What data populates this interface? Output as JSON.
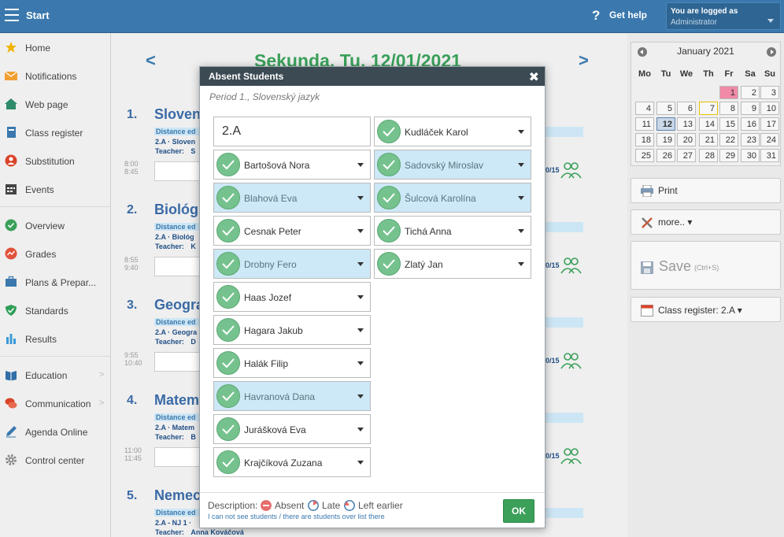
{
  "topbar": {
    "title": "Start",
    "help_icon": "?",
    "help_label": "Get help",
    "logged_label": "You are logged as",
    "user": "Administrator"
  },
  "sidebar": {
    "items": [
      {
        "label": "Home",
        "icon": "star-icon"
      },
      {
        "label": "Notifications",
        "icon": "envelope-icon"
      },
      {
        "label": "Web page",
        "icon": "house-icon"
      },
      {
        "label": "Class register",
        "icon": "book-icon"
      },
      {
        "label": "Substitution",
        "icon": "person-icon"
      },
      {
        "label": "Events",
        "icon": "calendar-icon"
      },
      {
        "label": "Overview",
        "icon": "check-circle-icon"
      },
      {
        "label": "Grades",
        "icon": "chart-circle-icon"
      },
      {
        "label": "Plans & Prepar...",
        "icon": "briefcase-icon"
      },
      {
        "label": "Standards",
        "icon": "shield-icon"
      },
      {
        "label": "Results",
        "icon": "bar-chart-icon"
      },
      {
        "label": "Education",
        "icon": "book-open-icon"
      },
      {
        "label": "Communication",
        "icon": "chat-icon"
      },
      {
        "label": "Agenda Online",
        "icon": "pen-icon"
      },
      {
        "label": "Control center",
        "icon": "gear-icon"
      }
    ]
  },
  "main": {
    "day_title": "Sekunda, Tu, 12/01/2021",
    "periods": [
      {
        "num": "1.",
        "name": "Sloven",
        "strip": "Distance ed",
        "line1": "2.A · Sloven",
        "line2_label": "Teacher:",
        "line2_value": "S",
        "t1": "8:00",
        "t2": "8:45",
        "count": "0/15"
      },
      {
        "num": "2.",
        "name": "Biológ",
        "strip": "Distance ed",
        "line1": "2.A · Biológ",
        "line2_label": "Teacher:",
        "line2_value": "K",
        "t1": "8:55",
        "t2": "9:40",
        "count": "0/15"
      },
      {
        "num": "3.",
        "name": "Geogra",
        "strip": "Distance ed",
        "line1": "2.A · Geogra",
        "line2_label": "Teacher:",
        "line2_value": "D",
        "t1": "9:55",
        "t2": "10:40",
        "count": "0/15"
      },
      {
        "num": "4.",
        "name": "Matem",
        "strip": "Distance ed",
        "line1": "2.A · Matem",
        "line2_label": "Teacher:",
        "line2_value": "B",
        "t1": "11:00",
        "t2": "11:45",
        "count": "0/15"
      },
      {
        "num": "5.",
        "name": "Nemec",
        "strip": "Distance ed",
        "line1": "2.A - NJ 1 ·",
        "line2_label": "Teacher:",
        "line2_value": "Anna Kováčová",
        "t1": "",
        "t2": "",
        "count": ""
      }
    ]
  },
  "calendar": {
    "month": "January 2021",
    "dow": [
      "Mo",
      "Tu",
      "We",
      "Th",
      "Fr",
      "Sa",
      "Su"
    ],
    "weeks": [
      [
        "",
        "",
        "",
        "",
        "1",
        "2",
        "3"
      ],
      [
        "4",
        "5",
        "6",
        "7",
        "8",
        "9",
        "10"
      ],
      [
        "11",
        "12",
        "13",
        "14",
        "15",
        "16",
        "17"
      ],
      [
        "18",
        "19",
        "20",
        "21",
        "22",
        "23",
        "24"
      ],
      [
        "25",
        "26",
        "27",
        "28",
        "29",
        "30",
        "31"
      ]
    ],
    "today": "12",
    "holiday": "1"
  },
  "right": {
    "print": "Print",
    "more": "more.. ▾",
    "save": "Save",
    "save_shortcut": "(Ctrl+S)",
    "class_register": "Class register: 2.A ▾"
  },
  "modal": {
    "title": "Absent Students",
    "close": "✖",
    "subtitle": "Period 1., Slovenský jazyk",
    "class": "2.A",
    "students_left": [
      {
        "name": "Bartošová Nora",
        "absent": false
      },
      {
        "name": "Blahová Eva",
        "absent": true
      },
      {
        "name": "Cesnak Peter",
        "absent": false
      },
      {
        "name": "Drobny Fero",
        "absent": true
      },
      {
        "name": "Haas Jozef",
        "absent": false
      },
      {
        "name": "Hagara Jakub",
        "absent": false
      },
      {
        "name": "Halák Filip",
        "absent": false
      },
      {
        "name": "Havranová Dana",
        "absent": true
      },
      {
        "name": "Jurášková Eva",
        "absent": false
      },
      {
        "name": "Krajčíková Zuzana",
        "absent": false
      }
    ],
    "students_right": [
      {
        "name": "Kudláček Karol",
        "absent": false
      },
      {
        "name": "Sadovský Miroslav",
        "absent": true
      },
      {
        "name": "Šulcová Karolína",
        "absent": true
      },
      {
        "name": "Tichá Anna",
        "absent": false
      },
      {
        "name": "Zlatý Jan",
        "absent": false
      }
    ],
    "description_label": "Description:",
    "legend": {
      "absent": "Absent",
      "late": "Late",
      "left": "Left earlier"
    },
    "link": "I can not see students / there are students over list there",
    "ok": "OK"
  }
}
